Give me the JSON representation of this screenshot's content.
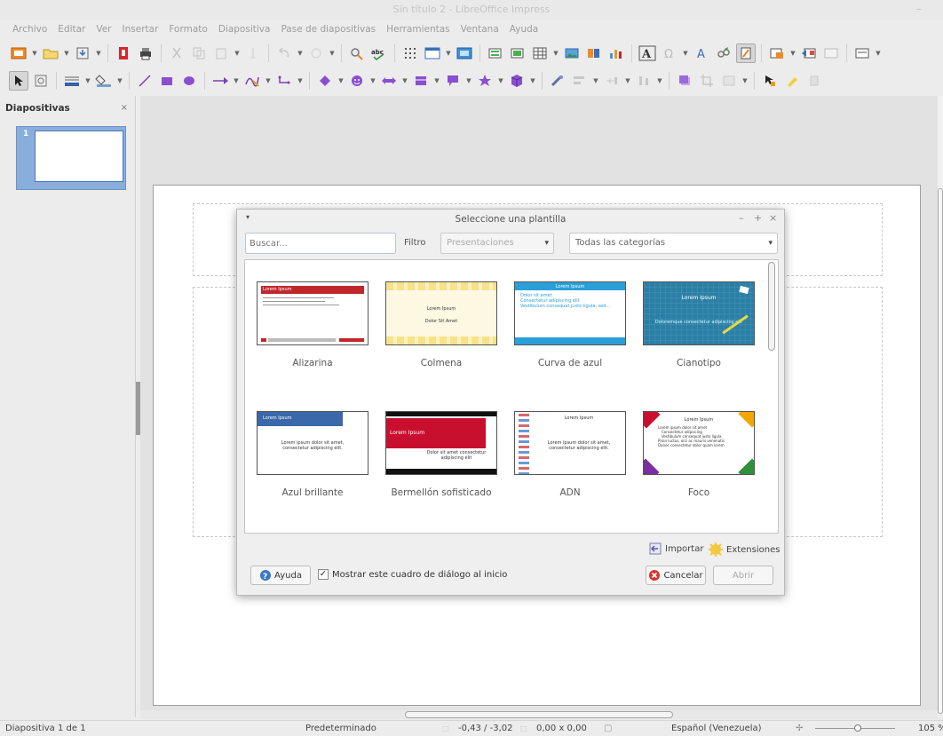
{
  "window": {
    "title": "Sin título 2 - LibreOffice Impress",
    "controls": "–"
  },
  "menubar": {
    "items": [
      "Archivo",
      "Editar",
      "Ver",
      "Insertar",
      "Formato",
      "Diapositiva",
      "Pase de diapositivas",
      "Herramientas",
      "Ventana",
      "Ayuda"
    ]
  },
  "left_panel": {
    "title": "Diapositivas",
    "close": "×",
    "slide_number": "1"
  },
  "dialog": {
    "title": "Seleccione una plantilla",
    "menu_glyph": "▾",
    "minimize": "–",
    "maximize": "+",
    "close": "×",
    "search_placeholder": "Buscar...",
    "filter_label": "Filtro",
    "filter_value": "Presentaciones",
    "category_value": "Todas las categorías",
    "dropdown_arrow": "▾",
    "templates": [
      {
        "name": "Alizarina",
        "thumb_title": "Lorem Ipsum"
      },
      {
        "name": "Colmena",
        "thumb_title": "Lorem Ipsum",
        "thumb_sub": "Dolor Sit Amet"
      },
      {
        "name": "Curva de azul",
        "thumb_title": "Lorem Ipsum",
        "thumb_lines": [
          "Dolor sit amet",
          "Consectetur adipiscing elit",
          "Vestibulum consequat justo ligula, sed..."
        ]
      },
      {
        "name": "Cianotipo",
        "thumb_title": "Lorem Ipsum",
        "thumb_sub": "Doloremque consectetur adipiscing elit"
      },
      {
        "name": "Azul brillante",
        "thumb_title": "Lorem Ipsum",
        "thumb_sub": "Lorem ipsum dolor sit amet, consectetur adipiscing elit."
      },
      {
        "name": "Bermellón sofisticado",
        "thumb_title": "Lorem Ipsum",
        "thumb_sub": "Dolor sit amet consectetur adipiscing elit"
      },
      {
        "name": "ADN",
        "thumb_title": "Lorem Ipsum",
        "thumb_sub": "Lorem ipsum dolor sit amet, consectetur adipiscing elit."
      },
      {
        "name": "Foco",
        "thumb_title": "Lorem Ipsum",
        "thumb_lines": [
          "Lorem ipsum dolor sit amet",
          "Consectetur adipiscing",
          "Vestibulum consequat justo ligula",
          "Proin luctus, orci ac mauris venenatis",
          "Donec consectetur dolor quam lorem"
        ]
      }
    ],
    "import_label": "Importar",
    "extensions_label": "Extensiones",
    "help_label": "Ayuda",
    "show_dialog_label": "Mostrar este cuadro de diálogo al inicio",
    "show_dialog_checked": true,
    "checkmark": "✓",
    "cancel_label": "Cancelar",
    "open_label": "Abrir"
  },
  "statusbar": {
    "slide": "Diapositiva 1 de 1",
    "layout": "Predeterminado",
    "position": "-0,43 / -3,02",
    "size": "0,00 x 0,00",
    "language": "Español (Venezuela)",
    "zoom": "105 %"
  },
  "colors": {
    "accent": "#3b6fb6",
    "alizarin_red": "#c0272d",
    "dialog_bg": "#efefef",
    "toolbar_bg": "#ececec"
  }
}
